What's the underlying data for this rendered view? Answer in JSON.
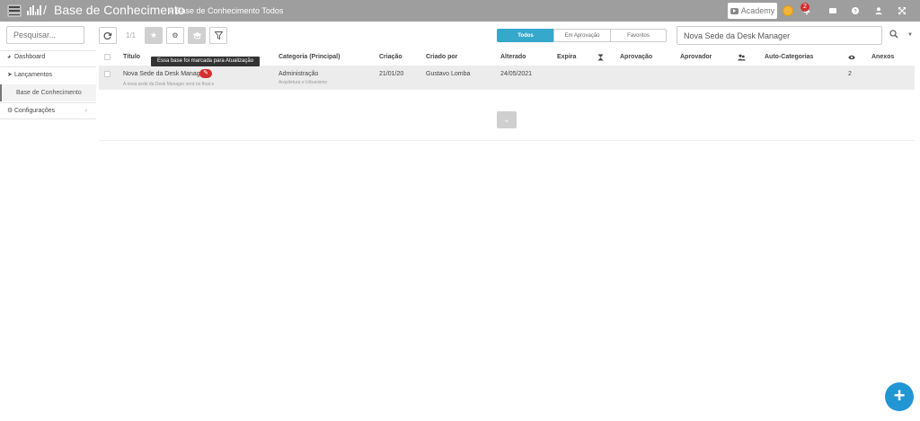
{
  "header": {
    "title": "Base de Conhecimento",
    "separator": "/",
    "breadcrumb": "» Base de Conhecimento Todos",
    "academy_label": "Academy",
    "notification_count": "2",
    "bg_color": "#9e9e9e"
  },
  "sidebar": {
    "search_placeholder": "Pesquisar...",
    "items": [
      {
        "label": "Dashboard",
        "icon": "dashboard-icon"
      },
      {
        "label": "Lançamentos",
        "icon": "paper-plane-icon"
      },
      {
        "label": "Base de Conhecimento",
        "icon": ""
      },
      {
        "label": "Configurações",
        "icon": "gear-icon"
      }
    ]
  },
  "toolbar": {
    "pagination": "1/1",
    "tabs": [
      {
        "label": "Todos",
        "active": true
      },
      {
        "label": "Em Aprovação",
        "active": false
      },
      {
        "label": "Favoritos",
        "active": false
      }
    ],
    "search_value": "Nova Sede da Desk Manager",
    "accent_color": "#35a8cc"
  },
  "table": {
    "columns": {
      "title": "Título",
      "category": "Categoria (Principal)",
      "created": "Criação",
      "created_by": "Criado por",
      "changed": "Alterado",
      "expires": "Expira",
      "approval": "Aprovação",
      "approver": "Aprovador",
      "auto_categories": "Auto-Categorias",
      "attachments": "Anexos"
    },
    "rows": [
      {
        "title": "Nova Sede da Desk Manager",
        "excerpt": "A nova sede da Desk Manager será no final e",
        "category": "Administração",
        "subcategory": "Arquitetura e Urbanismo",
        "created": "21/01/20",
        "created_by": "Gustavo Lomba",
        "changed": "24/05/2021",
        "views": "2"
      }
    ],
    "tooltip": "Essa base foi marcada para Atualização"
  },
  "fab": {
    "label": "+",
    "color": "#2196d3"
  }
}
